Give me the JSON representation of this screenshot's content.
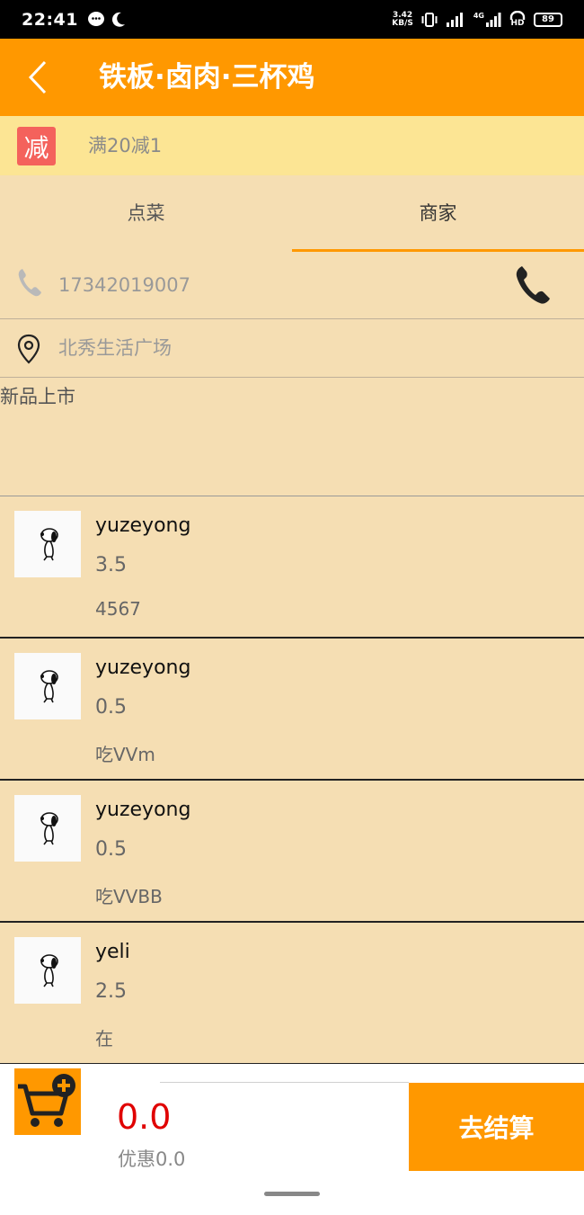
{
  "status_bar": {
    "time": "22:41",
    "speed_value": "3.42",
    "speed_unit": "KB/S",
    "network_label": "4G",
    "hd_label": "HD",
    "battery": "89"
  },
  "header": {
    "title": "铁板·卤肉·三杯鸡"
  },
  "promo": {
    "badge": "减",
    "text": "满20减1"
  },
  "tabs": [
    {
      "label": "点菜",
      "active": false
    },
    {
      "label": "商家",
      "active": true
    }
  ],
  "merchant": {
    "phone": "17342019007",
    "address": "北秀生活广场",
    "description": "新品上市"
  },
  "reviews": [
    {
      "name": "yuzeyong",
      "score": "3.5",
      "text": "4567"
    },
    {
      "name": "yuzeyong",
      "score": "0.5",
      "text": "吃VVm"
    },
    {
      "name": "yuzeyong",
      "score": "0.5",
      "text": "吃VVBB"
    },
    {
      "name": "yeli",
      "score": "2.5",
      "text": "在"
    }
  ],
  "cart": {
    "total": "0.0",
    "discount": "优惠0.0",
    "checkout_label": "去结算"
  },
  "colors": {
    "accent": "#ff9800",
    "promo_bg": "#fce594",
    "body_bg": "#f5deb3",
    "badge_red": "#f4625c",
    "price_red": "#e00000"
  }
}
